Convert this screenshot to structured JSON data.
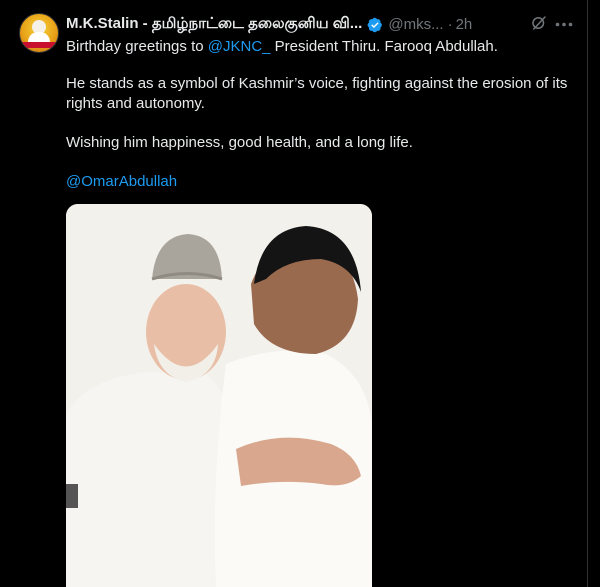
{
  "tweet": {
    "author_name": "M.K.Stalin - தமிழ்நாட்டை தலைகுனிய வி...",
    "handle": "@mks...",
    "separator": "·",
    "time": "2h",
    "lines": {
      "greeting_prefix": "Birthday greetings to ",
      "greeting_mention": "@JKNC_",
      "greeting_suffix": " President Thiru. Farooq Abdullah.",
      "paragraph2": "He stands as a symbol of Kashmir’s voice, fighting against the erosion of its rights and autonomy.",
      "paragraph3": "Wishing him happiness, good health, and a long life.",
      "mention2": "@OmarAbdullah"
    }
  },
  "icons": {
    "verified": "verified-badge-icon",
    "grok": "grok-icon",
    "more": "more-options-icon"
  },
  "colors": {
    "background": "#000000",
    "text": "#e7e9ea",
    "muted": "#71767b",
    "accent": "#1d9bf0"
  }
}
